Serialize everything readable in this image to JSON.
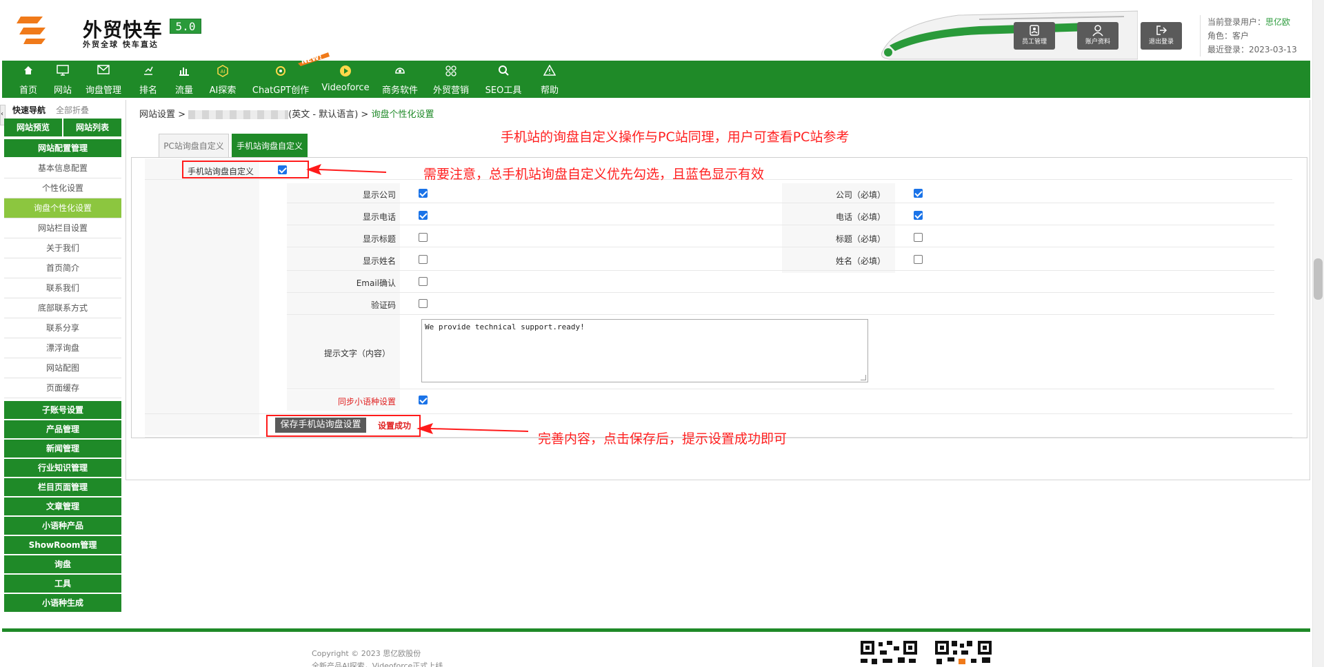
{
  "header": {
    "logo_title": "外贸快车",
    "logo_version": "5.0",
    "logo_sub": "外贸全球 快车直达",
    "buttons": [
      {
        "label": "员工管理"
      },
      {
        "label": "账户资料"
      },
      {
        "label": "退出登录"
      }
    ],
    "user": {
      "login_label": "当前登录用户：",
      "login_user": "思亿欧",
      "role": "角色：客户",
      "last_login": "最近登录：2023-03-13"
    }
  },
  "nav": {
    "new_badge": "NEW!",
    "items": [
      {
        "label": "首页"
      },
      {
        "label": "网站"
      },
      {
        "label": "询盘管理"
      },
      {
        "label": "排名"
      },
      {
        "label": "流量"
      },
      {
        "label": "AI探索"
      },
      {
        "label": "ChatGPT创作"
      },
      {
        "label": "Videoforce"
      },
      {
        "label": "商务软件"
      },
      {
        "label": "外贸营销"
      },
      {
        "label": "SEO工具"
      },
      {
        "label": "帮助"
      }
    ]
  },
  "sidebar": {
    "quick_nav": "快速导航",
    "collapse_all": "全部折叠",
    "collapse_arrow": "‹",
    "preview": "网站预览",
    "site_list": "网站列表",
    "config": "网站配置管理",
    "sub_items": [
      {
        "label": "基本信息配置"
      },
      {
        "label": "个性化设置"
      },
      {
        "label": "询盘个性化设置"
      },
      {
        "label": "网站栏目设置"
      },
      {
        "label": "关于我们"
      },
      {
        "label": "首页简介"
      },
      {
        "label": "联系我们"
      },
      {
        "label": "底部联系方式"
      },
      {
        "label": "联系分享"
      },
      {
        "label": "漂浮询盘"
      },
      {
        "label": "网站配图"
      },
      {
        "label": "页面缓存"
      }
    ],
    "groups": [
      {
        "label": "子账号设置"
      },
      {
        "label": "产品管理"
      },
      {
        "label": "新闻管理"
      },
      {
        "label": "行业知识管理"
      },
      {
        "label": "栏目页面管理"
      },
      {
        "label": "文章管理"
      },
      {
        "label": "小语种产品"
      },
      {
        "label": "ShowRoom管理"
      },
      {
        "label": "询盘"
      },
      {
        "label": "工具"
      },
      {
        "label": "小语种生成"
      }
    ]
  },
  "breadcrumb": {
    "part1": "网站设置 >",
    "part2": "(英文 - 默认语言) >",
    "current": "询盘个性化设置"
  },
  "tabs": {
    "pc": "PC站询盘自定义",
    "mobile": "手机站询盘自定义"
  },
  "form": {
    "master_label": "手机站询盘自定义",
    "master_checked": true,
    "show_company": "显示公司",
    "show_phone": "显示电话",
    "show_title": "显示标题",
    "show_name": "显示姓名",
    "email_confirm": "Email确认",
    "captcha": "验证码",
    "company_req": "公司（必填）",
    "phone_req": "电话（必填）",
    "title_req": "标题（必填）",
    "name_req": "姓名（必填）",
    "tip_label": "提示文字（内容）",
    "tip_value": "We provide technical support.ready!",
    "sync_label": "同步小语种设置",
    "save_button": "保存手机站询盘设置",
    "save_ok": "设置成功"
  },
  "annotations": {
    "top": "手机站的询盘自定义操作与PC站同理，用户可查看PC站参考",
    "middle": "需要注意，总手机站询盘自定义优先勾选，且蓝色显示有效",
    "bottom": "完善内容，点击保存后，提示设置成功即可"
  },
  "footer": {
    "copyright": "Copyright © 2023 思亿欧股份",
    "line2": "全新产品AI探索，Videoforce正式上线"
  },
  "colors": {
    "brand_green": "#1f8a28",
    "active_light_green": "#8cc63f",
    "annotation_red": "#ff2020",
    "checkbox_blue": "#1a73e8"
  }
}
